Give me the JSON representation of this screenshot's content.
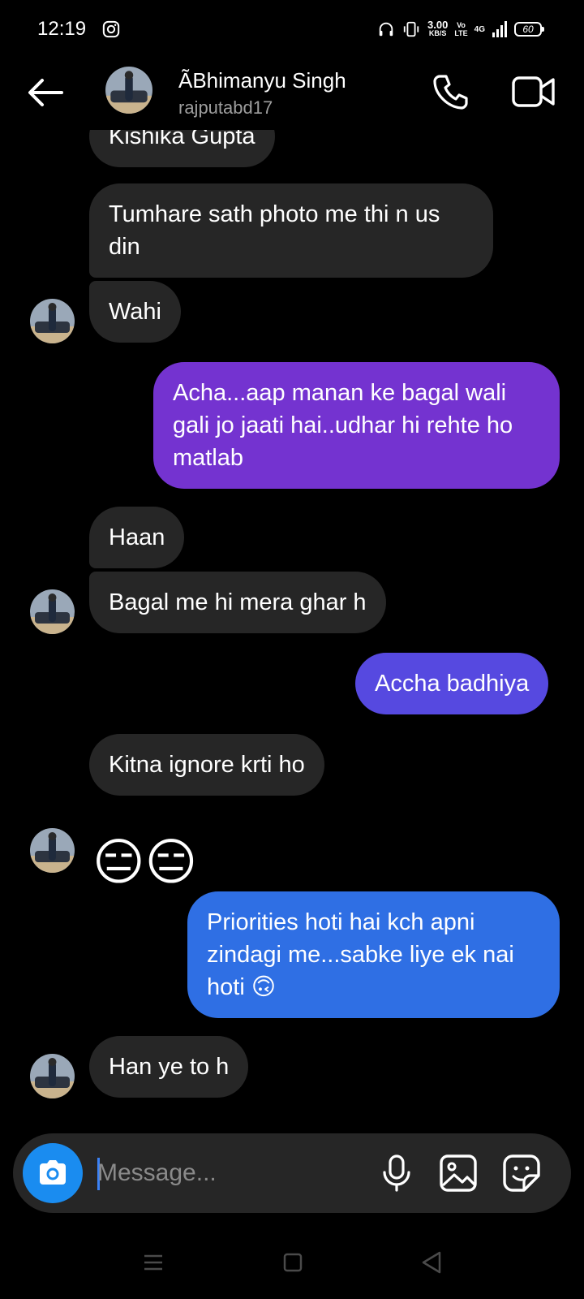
{
  "status_bar": {
    "time": "12:19",
    "speed_value": "3.00",
    "speed_unit": "KB/S",
    "volte_top": "Vo",
    "volte_bottom": "LTE",
    "network": "4G",
    "battery": "60"
  },
  "header": {
    "name": "ÃBhimanyu Singh",
    "username": "rajputabd17"
  },
  "messages": [
    {
      "from": "them",
      "text": "Kishika Gupta"
    },
    {
      "from": "them",
      "text": "Tumhare sath photo me thi n us din"
    },
    {
      "from": "them",
      "text": "Wahi"
    },
    {
      "from": "me",
      "text": "Acha...aap manan ke bagal wali gali jo jaati hai..udhar hi rehte ho matlab",
      "color": "#7433d0"
    },
    {
      "from": "them",
      "text": "Haan"
    },
    {
      "from": "them",
      "text": "Bagal me hi mera ghar h"
    },
    {
      "from": "me",
      "text": "Accha badhiya",
      "color": "#5649e0"
    },
    {
      "from": "them",
      "text": "Kitna ignore krti ho"
    },
    {
      "from": "them",
      "text": "😑😑"
    },
    {
      "from": "me",
      "text": "Priorities hoti hai kch apni zindagi me...sabke liye ek nai hoti 🙃",
      "color": "#2f6fe4"
    },
    {
      "from": "them",
      "text": "Han ye to h"
    }
  ],
  "composer": {
    "placeholder": "Message..."
  },
  "colors": {
    "received_bubble": "#262626",
    "camera_button": "#1a8cf0",
    "background": "#000000"
  },
  "icons": [
    "back-arrow-icon",
    "phone-icon",
    "video-camera-icon",
    "camera-icon",
    "microphone-icon",
    "gallery-icon",
    "sticker-icon"
  ]
}
